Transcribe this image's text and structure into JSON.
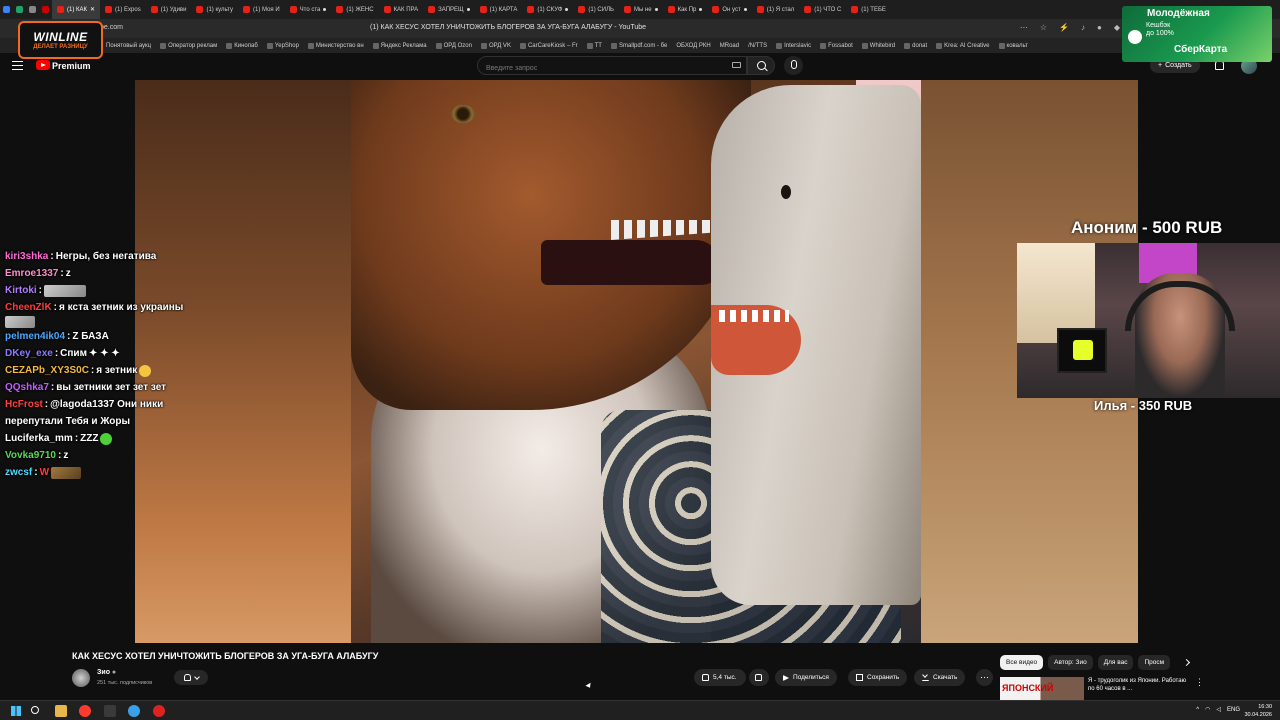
{
  "browser": {
    "tabs": [
      {
        "label": "(1) КАК",
        "active": true
      },
      {
        "label": "(1) Expos"
      },
      {
        "label": "(1) Удиви"
      },
      {
        "label": "(1) культу"
      },
      {
        "label": "(1) Моя И"
      },
      {
        "label": "Что ста"
      },
      {
        "label": "(1) ЖЕНС"
      },
      {
        "label": "КАК ПРА"
      },
      {
        "label": "ЗАПРЕЩ"
      },
      {
        "label": "(1) КАРТА"
      },
      {
        "label": "(1) СКУФ"
      },
      {
        "label": "(1) СИЛЬ"
      },
      {
        "label": "Мы не"
      },
      {
        "label": "Как Пр"
      },
      {
        "label": "Он уст"
      },
      {
        "label": "(1) Я стал"
      },
      {
        "label": "(1) ЧТО С"
      },
      {
        "label": "(1) ТЕБЕ"
      }
    ],
    "url": "be.com",
    "page_title": "(1) КАК ХЕСУС ХОТЕЛ УНИЧТОЖИТЬ БЛОГЕРОВ ЗА УГА-БУГА АЛАБУГУ - YouTube",
    "bookmarks": [
      "Понятовый аукц",
      "Оператор реклам",
      "Кинопаб",
      "YepShop",
      "Министерство вн",
      "Яндекс Реклама",
      "ОРД Ozon",
      "ОРД VK",
      "CarCareKiosk – Fr",
      "TT",
      "Smallpdf.com - бе",
      "ОБХОД РКН",
      "MRoad",
      "/N/TTS",
      "Interslavic",
      "Fossabot",
      "Whitebird",
      "donat",
      "Krea: AI Creative",
      "ковальт"
    ]
  },
  "ads": {
    "winline": {
      "name": "WINLINE",
      "tagline": "ДЕЛАЕТ РАЗНИЦУ"
    },
    "sber": {
      "headline": "Молодёжная",
      "offer_line1": "Кешбэк",
      "offer_line2": "до 100%",
      "brand": "СберКарта"
    }
  },
  "youtube": {
    "brand": "Premium",
    "search_placeholder": "Введите запрос",
    "create_label": "Создать"
  },
  "chat": [
    {
      "user": "kiri3shka",
      "color": "#ff6bd6",
      "text": "Негры, без негатива"
    },
    {
      "user": "Emroe1337",
      "color": "#ff8ec8",
      "text": "z"
    },
    {
      "user": "Kirtoki",
      "color": "#b27cff",
      "text": ""
    },
    {
      "user": "CheenZlK",
      "color": "#ff3b3b",
      "text": "я кста зетник из украины"
    },
    {
      "user": "",
      "color": "#ffffff",
      "text": ""
    },
    {
      "user": "pelmen4ik04",
      "color": "#4aa8ff",
      "text": "Z БАЗА"
    },
    {
      "user": "DKey_exe",
      "color": "#8a7bff",
      "text": "Спим"
    },
    {
      "user": "CEZAPb_XY3S0C",
      "color": "#f5b942",
      "text": "я зетник"
    },
    {
      "user": "QQshka7",
      "color": "#c45cff",
      "text": "вы зетники зет зет зет"
    },
    {
      "user": "HcFrost",
      "color": "#ff4040",
      "text": "@lagoda1337 Они ники"
    },
    {
      "user": "",
      "color": "#ffffff",
      "text": "перепутали  Тебя и Жоры"
    },
    {
      "user": "Luciferka_mm",
      "color": "#ffffff",
      "text": "ZZZ"
    },
    {
      "user": "Vovka9710",
      "color": "#5cd65c",
      "text": "z"
    },
    {
      "user": "zwcsf",
      "color": "#4fd8ff",
      "text": "W"
    }
  ],
  "donations": {
    "top": "Аноним - 500 RUB",
    "bottom": "Илья - 350 RUB"
  },
  "video": {
    "title": "КАК ХЕСУС ХОТЕЛ УНИЧТОЖИТЬ БЛОГЕРОВ ЗА УГА-БУГА АЛАБУГУ",
    "channel": "Зио",
    "subscribers": "251 тыс. подписчиков",
    "likes": "5,4 тыс.",
    "share": "Поделиться",
    "save": "Сохранить",
    "download": "Скачать"
  },
  "sidebar": {
    "chips": [
      "Все видео",
      "Автор: Зио",
      "Для вас",
      "Просм"
    ],
    "rec": {
      "thumb_text": "ЯПОНСКИЙ",
      "title": "Я - трудоголик из Японии. Работаю по 60 часов в ..."
    }
  },
  "taskbar": {
    "lang": "ENG",
    "time": "16:30",
    "date": "30.04.2026"
  },
  "colors": {
    "accent": "#ff0000",
    "winline": "#f26a1b",
    "sber": "#1a9a4f"
  }
}
